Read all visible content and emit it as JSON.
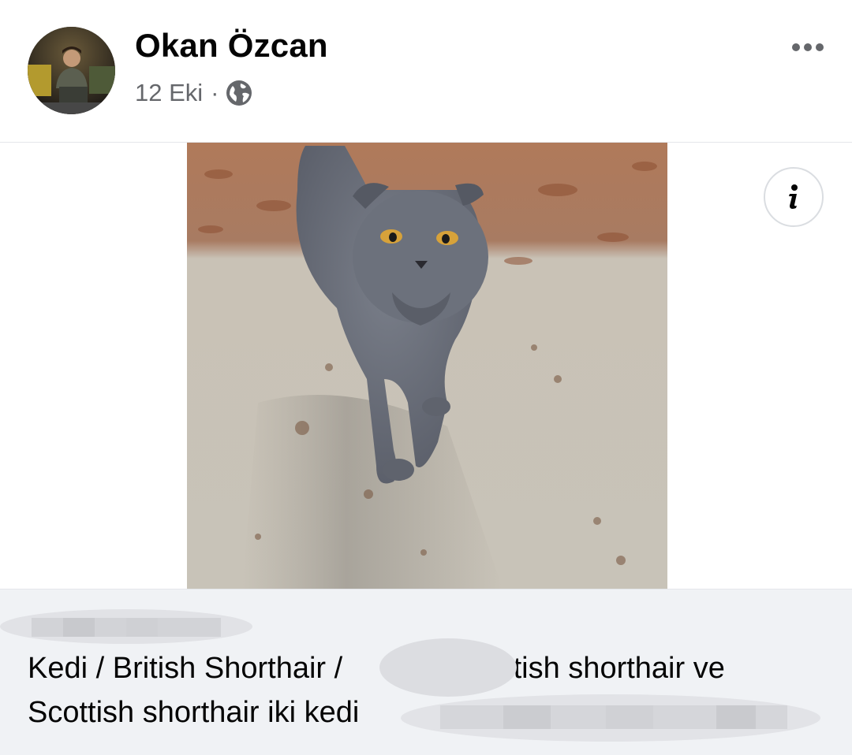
{
  "post": {
    "author_name": "Okan Özcan",
    "timestamp": "12 Eki",
    "separator": "·",
    "privacy_icon": "globe-icon",
    "more_icon": "more-horizontal-icon",
    "info_icon": "info-icon",
    "avatar_description": "profile-photo",
    "media_icon": "cat-photo"
  },
  "link_preview": {
    "title_line1_left": "Kedi / British Shorthair /",
    "title_line1_right": "British shorthair ve",
    "title_line2": "Scottish shorthair iki kedi"
  },
  "colors": {
    "text_primary": "#050505",
    "text_secondary": "#65676b",
    "preview_background": "#f0f2f5",
    "divider": "#e4e6ea"
  }
}
